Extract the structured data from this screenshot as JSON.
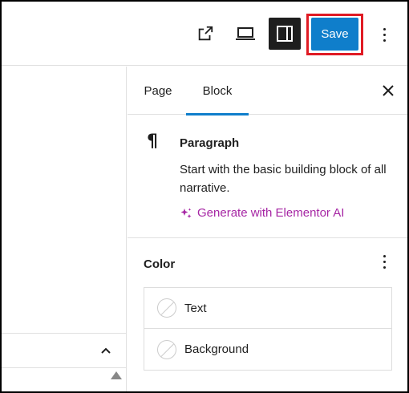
{
  "toolbar": {
    "external_icon": "external-link-icon",
    "view_icon": "desktop-view-icon",
    "panel_icon": "sidebar-toggle-icon",
    "save_label": "Save",
    "more_icon": "more-vertical-icon",
    "save_color": "#0f7ecb",
    "highlight_color": "#e01b24"
  },
  "canvas": {
    "collapse_icon": "chevron-up-icon",
    "scroll_icon": "triangle-up-icon"
  },
  "sidebar": {
    "tabs": [
      {
        "label": "Page",
        "active": false
      },
      {
        "label": "Block",
        "active": true
      }
    ],
    "close_icon": "close-icon",
    "block": {
      "icon": "¶",
      "title": "Paragraph",
      "description": "Start with the basic building block of all narrative.",
      "ai_link": "Generate with Elementor AI",
      "ai_color": "#a626a4"
    },
    "color": {
      "title": "Color",
      "items": [
        {
          "label": "Text"
        },
        {
          "label": "Background"
        }
      ]
    }
  }
}
